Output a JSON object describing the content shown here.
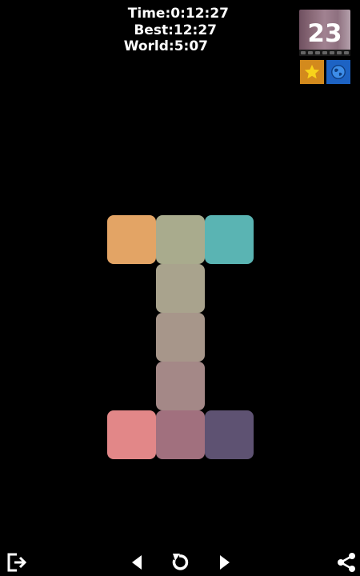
{
  "stats": {
    "time": "Time:0:12:27",
    "best": "Best:12:27",
    "world": "World:5:07"
  },
  "level": {
    "number": "23"
  },
  "badges": [
    {
      "icon": "star-icon",
      "color": "#d38a1d"
    },
    {
      "icon": "globe-icon",
      "color": "#1d63c4"
    }
  ],
  "board": {
    "tiles": [
      {
        "color": "#e3a465"
      },
      {
        "color": "#a9ab8d"
      },
      {
        "color": "#5ab4b3"
      },
      {
        "color": "#a9a38d"
      },
      {
        "color": "#a7968a"
      },
      {
        "color": "#a48887"
      },
      {
        "color": "#e28788"
      },
      {
        "color": "#a1707e"
      },
      {
        "color": "#5e5272"
      }
    ]
  },
  "toolbar": {
    "icons": [
      "exit-icon",
      "previous-icon",
      "restart-icon",
      "next-icon",
      "share-icon"
    ]
  }
}
